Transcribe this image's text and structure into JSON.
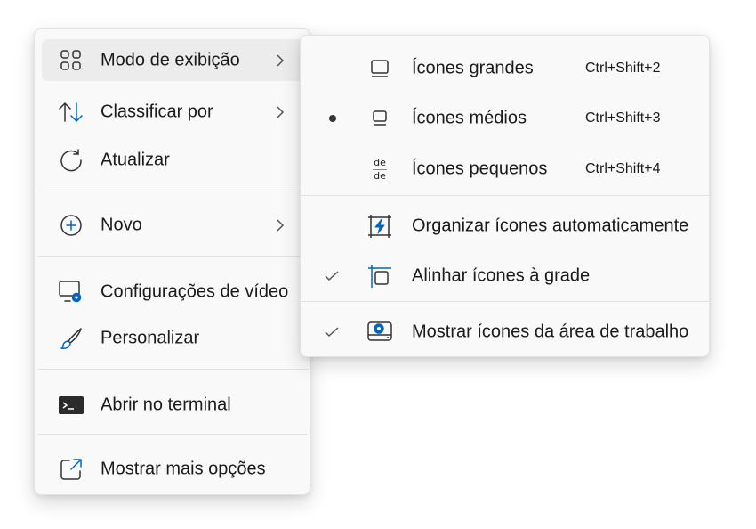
{
  "main_menu": {
    "items": [
      {
        "label": "Modo de exibição",
        "icon": "grid-view-icon",
        "has_submenu": true
      },
      {
        "label": "Classificar por",
        "icon": "sort-arrows-icon",
        "has_submenu": true
      },
      {
        "label": "Atualizar",
        "icon": "refresh-icon",
        "has_submenu": false
      },
      {
        "label": "Novo",
        "icon": "add-circle-icon",
        "has_submenu": true
      },
      {
        "label": "Configurações de vídeo",
        "icon": "display-settings-icon",
        "has_submenu": false
      },
      {
        "label": "Personalizar",
        "icon": "brush-icon",
        "has_submenu": false
      },
      {
        "label": "Abrir no terminal",
        "icon": "terminal-icon",
        "has_submenu": false
      },
      {
        "label": "Mostrar mais opções",
        "icon": "open-external-icon",
        "has_submenu": false
      }
    ]
  },
  "sub_menu": {
    "items": [
      {
        "label": "Ícones grandes",
        "shortcut": "Ctrl+Shift+2",
        "icon": "large-icons-icon",
        "selected": false
      },
      {
        "label": "Ícones médios",
        "shortcut": "Ctrl+Shift+3",
        "icon": "medium-icons-icon",
        "selected": true
      },
      {
        "label": "Ícones pequenos",
        "shortcut": "Ctrl+Shift+4",
        "icon": "small-icons-icon",
        "icon_text": "de",
        "selected": false
      },
      {
        "label": "Organizar ícones automaticamente",
        "icon": "auto-arrange-icon",
        "checked": false
      },
      {
        "label": "Alinhar ícones à grade",
        "icon": "align-grid-icon",
        "checked": true
      },
      {
        "label": "Mostrar ícones da área de trabalho",
        "icon": "show-desktop-icons-icon",
        "checked": true
      }
    ]
  },
  "colors": {
    "accent": "#0067c0",
    "menu_bg": "#f9f9f9",
    "hover_bg": "#ececec",
    "text": "#1b1b1b"
  }
}
